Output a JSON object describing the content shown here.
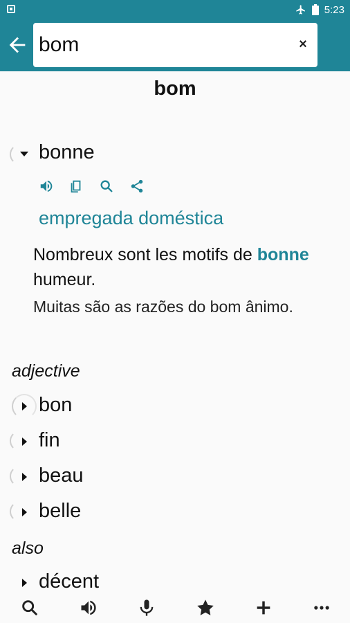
{
  "status_bar": {
    "time": "5:23",
    "icons": [
      "notification-icon",
      "airplane-mode-icon",
      "battery-icon"
    ]
  },
  "toolbar": {
    "back_icon": "arrow-left-icon",
    "search_value": "bom",
    "clear_icon": "close-icon",
    "clear_label": "×"
  },
  "headword": "bom",
  "entries": [
    {
      "word": "bonne",
      "expanded": true,
      "actions": [
        "speaker-icon",
        "copy-icon",
        "search-icon",
        "share-icon"
      ],
      "translation": "empregada doméstica",
      "example": {
        "fr_before": "Nombreux sont les motifs de ",
        "fr_highlight": "bonne",
        "fr_after": " humeur.",
        "pt": "Muitas são as razões do bom ânimo."
      }
    }
  ],
  "sections": [
    {
      "label": "adjective",
      "words": [
        "bon",
        "fin",
        "beau",
        "belle"
      ]
    },
    {
      "label": "also",
      "words": [
        "décent"
      ]
    }
  ],
  "bottom_bar": {
    "icons": [
      "search-icon",
      "speaker-icon",
      "microphone-icon",
      "star-icon",
      "plus-icon",
      "more-icon"
    ]
  },
  "colors": {
    "accent": "#1f8597",
    "background": "#fafafa"
  }
}
